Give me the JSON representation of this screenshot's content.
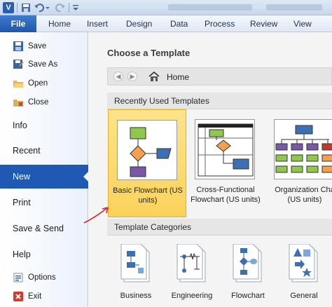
{
  "titlebar": {
    "app_icon_letter": "V"
  },
  "ribbon": {
    "file_tab": "File",
    "tabs": [
      "Home",
      "Insert",
      "Design",
      "Data",
      "Process",
      "Review",
      "View"
    ]
  },
  "leftnav": {
    "save": "Save",
    "save_as": "Save As",
    "open": "Open",
    "close": "Close",
    "info": "Info",
    "recent": "Recent",
    "new": "New",
    "print": "Print",
    "save_send": "Save & Send",
    "help": "Help",
    "options": "Options",
    "exit": "Exit"
  },
  "main": {
    "title": "Choose a Template",
    "breadcrumb_home": "Home",
    "recent_header": "Recently Used Templates",
    "categories_header": "Template Categories",
    "recent_templates": [
      {
        "line1": "Basic Flowchart (US",
        "line2": "units)"
      },
      {
        "line1": "Cross-Functional",
        "line2": "Flowchart (US units)"
      },
      {
        "line1": "Organization Cha",
        "line2": "(US units)"
      }
    ],
    "categories": [
      "Business",
      "Engineering",
      "Flowchart",
      "General"
    ]
  },
  "colors": {
    "accent": "#1f59b4",
    "selection": "#fbd35a"
  }
}
